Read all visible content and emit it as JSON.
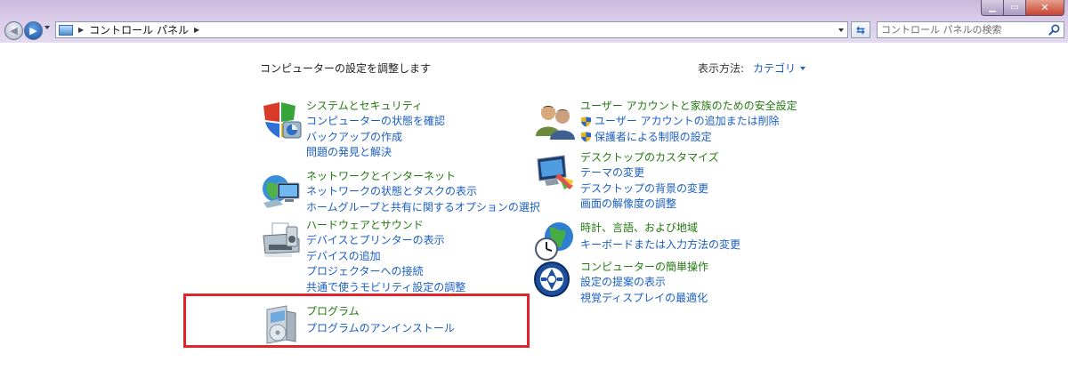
{
  "window": {
    "min_label": "▁",
    "max_label": "▭",
    "close_label": "✕"
  },
  "address_bar": {
    "crumbs": [
      "コントロール パネル"
    ],
    "refresh_icon": "refresh-icon"
  },
  "search": {
    "placeholder": "コントロール パネルの検索"
  },
  "header": {
    "title": "コンピューターの設定を調整します",
    "view_by_label": "表示方法:",
    "view_by_value": "カテゴリ"
  },
  "categories": [
    {
      "heading": "システムとセキュリティ",
      "icon": "shield-icon",
      "links": [
        "コンピューターの状態を確認",
        "バックアップの作成",
        "問題の発見と解決"
      ]
    },
    {
      "heading": "ネットワークとインターネット",
      "icon": "network-globe-icon",
      "links": [
        "ネットワークの状態とタスクの表示",
        "ホームグループと共有に関するオプションの選択"
      ]
    },
    {
      "heading": "ハードウェアとサウンド",
      "icon": "printer-icon",
      "links": [
        "デバイスとプリンターの表示",
        "デバイスの追加",
        "プロジェクターへの接続",
        "共通で使うモビリティ設定の調整"
      ]
    },
    {
      "heading": "プログラム",
      "icon": "programs-icon",
      "links": [
        "プログラムのアンインストール"
      ]
    },
    {
      "heading": "ユーザー アカウントと家族のための安全設定",
      "icon": "users-icon",
      "links": [
        "ユーザー アカウントの追加または削除",
        "保護者による制限の設定"
      ]
    },
    {
      "heading": "デスクトップのカスタマイズ",
      "icon": "desktop-icon",
      "links": [
        "テーマの変更",
        "デスクトップの背景の変更",
        "画面の解像度の調整"
      ]
    },
    {
      "heading": "時計、言語、および地域",
      "icon": "clock-globe-icon",
      "links": [
        "キーボードまたは入力方法の変更"
      ]
    },
    {
      "heading": "コンピューターの簡単操作",
      "icon": "ease-of-access-icon",
      "links": [
        "設定の提案の表示",
        "視覚ディスプレイの最適化"
      ]
    }
  ],
  "colors": {
    "heading_green": "#22780f",
    "link_blue": "#1a5ec2",
    "highlight_red": "#e1242c"
  }
}
